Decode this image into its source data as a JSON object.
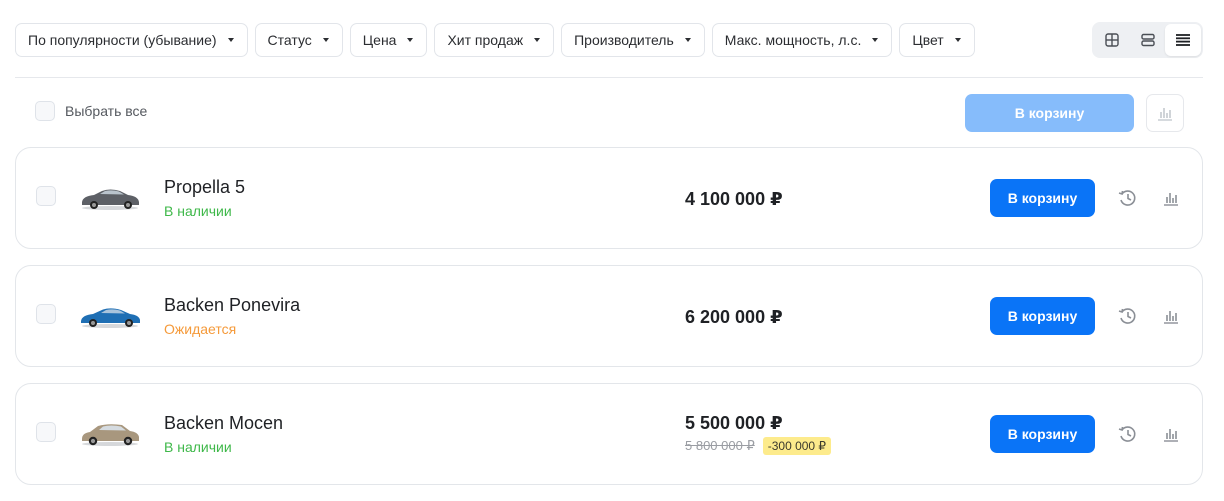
{
  "filters": [
    {
      "label": "По популярности (убывание)"
    },
    {
      "label": "Статус"
    },
    {
      "label": "Цена"
    },
    {
      "label": "Хит продаж"
    },
    {
      "label": "Производитель"
    },
    {
      "label": "Макс. мощность, л.с."
    },
    {
      "label": "Цвет"
    }
  ],
  "view_modes": {
    "options": [
      "grid-icon",
      "rows-icon",
      "list-icon"
    ],
    "active": "list-icon"
  },
  "toolbar": {
    "select_all_label": "Выбрать все",
    "cart_all_label": "В корзину"
  },
  "products": [
    {
      "name": "Propella 5",
      "status": "В наличии",
      "status_color": "#3fb84a",
      "car_color": "#5d6066",
      "price": "4 100 000 ₽",
      "cart_label": "В корзину"
    },
    {
      "name": "Backen Ponevira",
      "status": "Ожидается",
      "status_color": "#f59a3a",
      "car_color": "#1f6fb4",
      "price": "6 200 000 ₽",
      "cart_label": "В корзину"
    },
    {
      "name": "Backen Mocen",
      "status": "В наличии",
      "status_color": "#3fb84a",
      "car_color": "#a8977e",
      "price": "5 500 000 ₽",
      "old_price": "5 800 000 ₽",
      "discount": "-300 000 ₽",
      "cart_label": "В корзину"
    }
  ],
  "colors": {
    "accent": "#0a74f7",
    "accent_disabled": "#86bcfb",
    "discount_badge": "#fdeb8c"
  }
}
